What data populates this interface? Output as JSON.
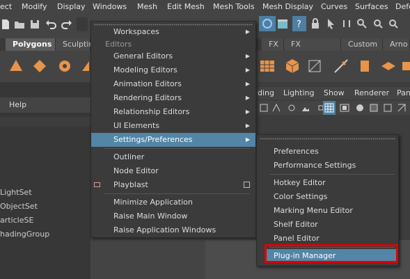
{
  "menubar": [
    "ect",
    "Modify",
    "Display",
    "Windows",
    "Mesh",
    "Edit Mesh",
    "Mesh Tools",
    "Mesh Display",
    "Curves",
    "Surfaces",
    "Defo"
  ],
  "shelf_tabs": [
    "Polygons",
    "Sculptin",
    "FX",
    "FX Caching",
    "Custom",
    "Arno"
  ],
  "left_menu": {
    "help": "Help"
  },
  "outliner": [
    "LightSet",
    "ObjectSet",
    "articleSE",
    "hadingGroup"
  ],
  "panel_menu": [
    "ding",
    "Lighting",
    "Show",
    "Renderer",
    "Pan"
  ],
  "menu": {
    "workspaces": "Workspaces",
    "editors_label": "Editors",
    "general_editors": "General Editors",
    "modeling_editors": "Modeling Editors",
    "animation_editors": "Animation Editors",
    "rendering_editors": "Rendering Editors",
    "relationship_editors": "Relationship Editors",
    "ui_elements": "UI Elements",
    "settings_prefs": "Settings/Preferences",
    "outliner": "Outliner",
    "node_editor": "Node Editor",
    "playblast": "Playblast",
    "minimize": "Minimize Application",
    "raise_main": "Raise Main Window",
    "raise_app": "Raise Application Windows"
  },
  "submenu": {
    "preferences": "Preferences",
    "performance": "Performance Settings",
    "hotkey": "Hotkey Editor",
    "color": "Color Settings",
    "marking_menu": "Marking Menu Editor",
    "shelf": "Shelf Editor",
    "panel": "Panel Editor",
    "plugin": "Plug-in Manager"
  },
  "colors": {
    "highlight": "#5285a6",
    "callout": "#e00000"
  }
}
